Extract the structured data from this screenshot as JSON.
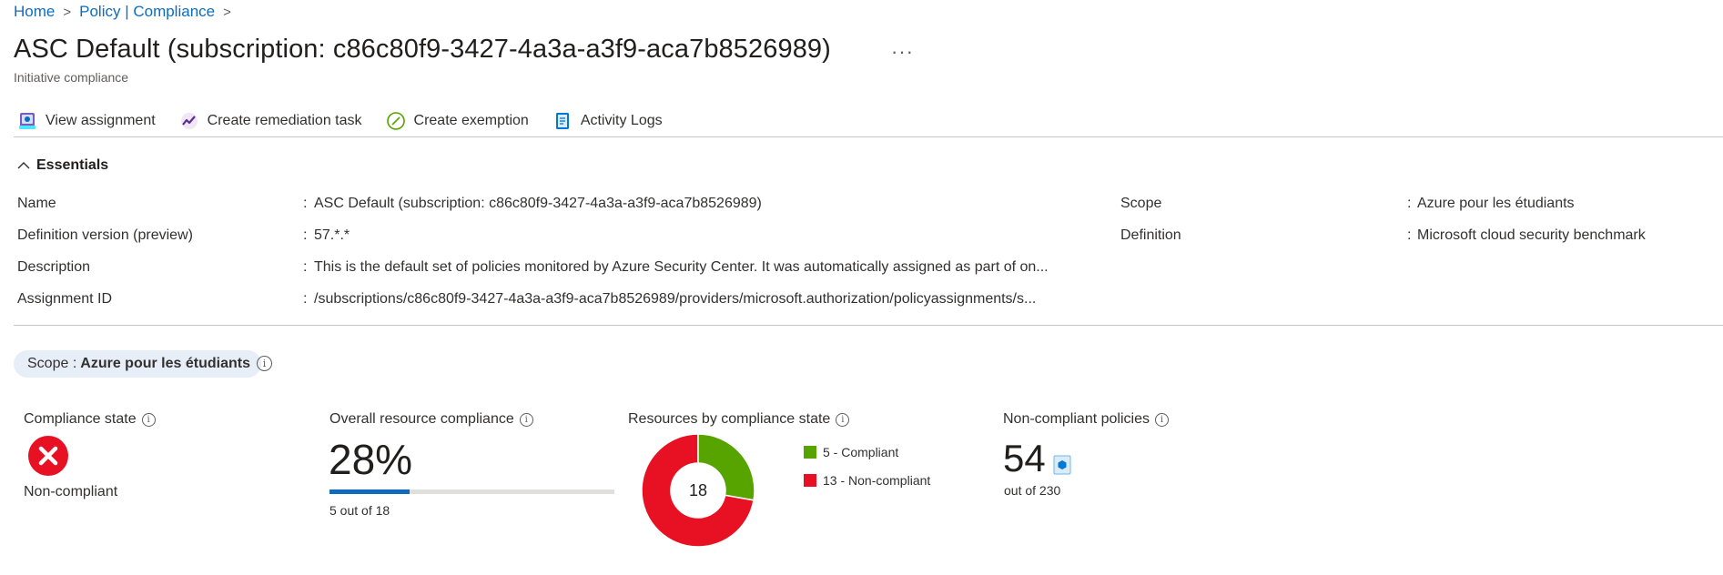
{
  "breadcrumb": {
    "items": [
      "Home",
      "Policy | Compliance"
    ],
    "separator": ">"
  },
  "header": {
    "title": "ASC Default (subscription: c86c80f9-3427-4a3a-a3f9-aca7b8526989)",
    "subtitle": "Initiative compliance",
    "more_label": "···"
  },
  "toolbar": {
    "view_assignment": "View assignment",
    "create_remediation": "Create remediation task",
    "create_exemption": "Create exemption",
    "activity_logs": "Activity Logs"
  },
  "essentials": {
    "heading": "Essentials",
    "left": [
      {
        "label": "Name",
        "value": "ASC Default (subscription: c86c80f9-3427-4a3a-a3f9-aca7b8526989)"
      },
      {
        "label": "Definition version (preview)",
        "value": "57.*.*"
      },
      {
        "label": "Description",
        "value": "This is the default set of policies monitored by Azure Security Center. It was automatically assigned as part of on..."
      },
      {
        "label": "Assignment ID",
        "value": "/subscriptions/c86c80f9-3427-4a3a-a3f9-aca7b8526989/providers/microsoft.authorization/policyassignments/s..."
      }
    ],
    "right": [
      {
        "label": "Scope",
        "value": "Azure pour les étudiants"
      },
      {
        "label": "Definition",
        "value": "Microsoft cloud security benchmark"
      }
    ],
    "separator": ":"
  },
  "scope_filter": {
    "label": "Scope :",
    "value": "Azure pour les étudiants"
  },
  "tiles": {
    "compliance_state": {
      "label": "Compliance state",
      "value": "Non-compliant",
      "icon": "error-circle-icon",
      "color": "#e81123"
    },
    "overall": {
      "label": "Overall resource compliance",
      "value": "28%",
      "percent": 28,
      "caption": "5 out of 18",
      "bar_color": "#0f6cbd"
    },
    "resources": {
      "label": "Resources by compliance state",
      "total": "18",
      "legend": [
        {
          "label": "5 - Compliant",
          "count": 5,
          "color": "#57a300"
        },
        {
          "label": "13 - Non-compliant",
          "count": 13,
          "color": "#e81123"
        }
      ]
    },
    "policies": {
      "label": "Non-compliant policies",
      "value": "54",
      "caption": "out of 230",
      "icon": "policy-document-icon"
    }
  }
}
